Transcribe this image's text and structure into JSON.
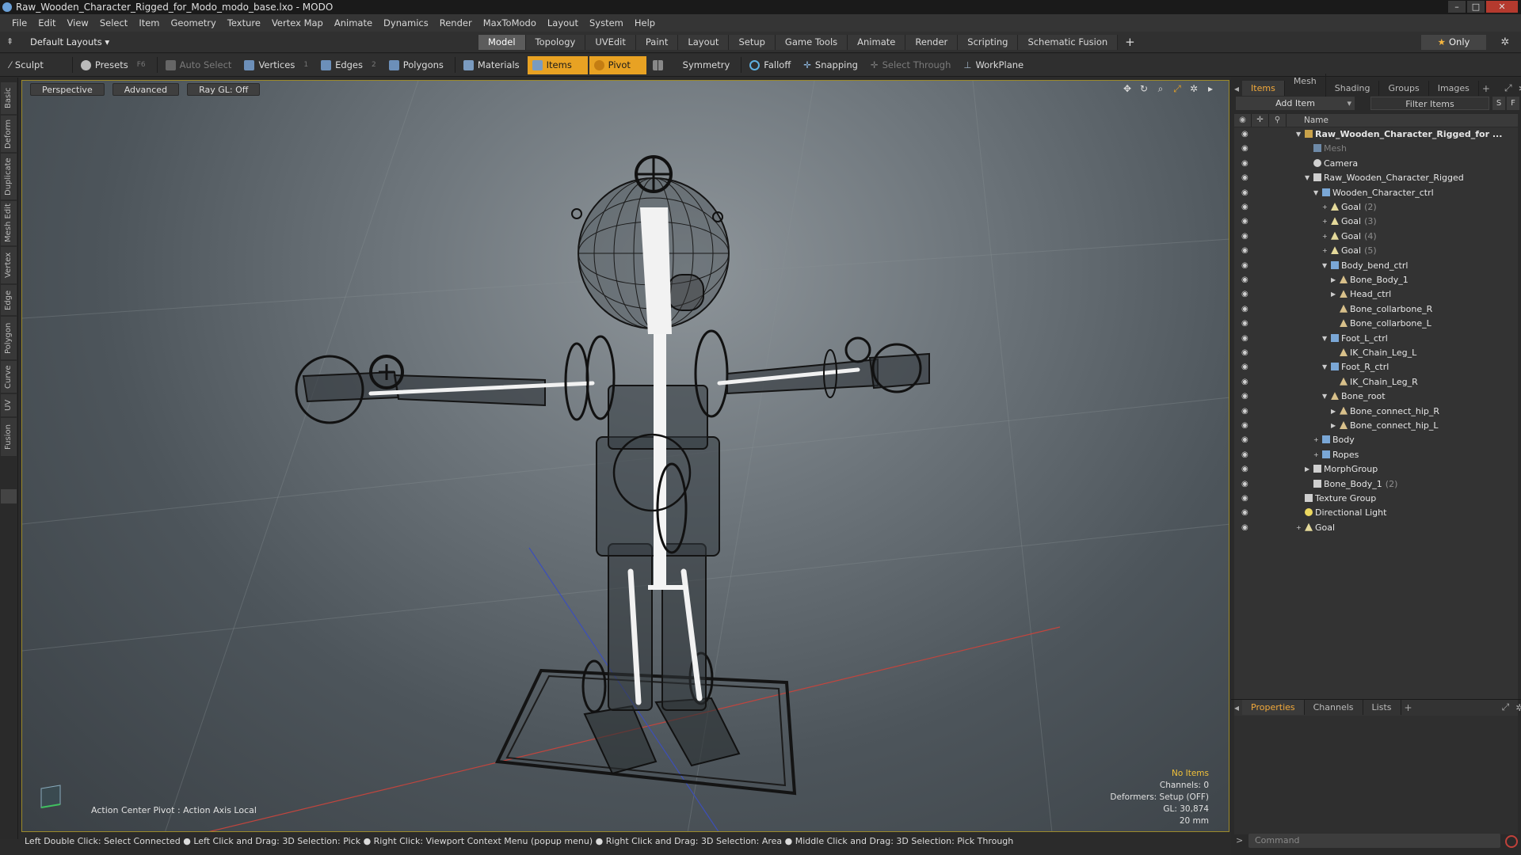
{
  "window": {
    "title": "Raw_Wooden_Character_Rigged_for_Modo_modo_base.lxo - MODO",
    "buttons": [
      "–",
      "□",
      "✕"
    ]
  },
  "menu": [
    "File",
    "Edit",
    "View",
    "Select",
    "Item",
    "Geometry",
    "Texture",
    "Vertex Map",
    "Animate",
    "Dynamics",
    "Render",
    "MaxToModo",
    "Layout",
    "System",
    "Help"
  ],
  "layout": {
    "selector": "Default Layouts ▾",
    "tabs": [
      "Model",
      "Topology",
      "UVEdit",
      "Paint",
      "Layout",
      "Setup",
      "Game Tools",
      "Animate",
      "Render",
      "Scripting",
      "Schematic Fusion"
    ],
    "active_tab": "Model",
    "add_tab": "+",
    "only_label": "Only"
  },
  "toolbar": {
    "sculpt": "Sculpt",
    "presets": "Presets",
    "presets_key": "F6",
    "auto_select": "Auto Select",
    "vertices": "Vertices",
    "vertices_key": "1",
    "edges": "Edges",
    "edges_key": "2",
    "polygons": "Polygons",
    "materials": "Materials",
    "items": "Items",
    "pivot": "Pivot",
    "symmetry": "Symmetry",
    "falloff": "Falloff",
    "snapping": "Snapping",
    "select_through": "Select Through",
    "workplane": "WorkPlane"
  },
  "left_tabs": [
    "Basic",
    "Deform",
    "Duplicate",
    "Mesh Edit",
    "Vertex",
    "Edge",
    "Polygon",
    "Curve",
    "UV",
    "Fusion"
  ],
  "viewport": {
    "view_mode": "Perspective",
    "shading": "Advanced",
    "raygl": "Ray GL: Off",
    "info_noitems": "No Items",
    "info_channels": "Channels: 0",
    "info_deformers": "Deformers: Setup (OFF)",
    "info_gl": "GL: 30,874",
    "info_scale": "20 mm",
    "action_center": "Action Center Pivot : Action Axis Local"
  },
  "status_bar": "Left Double Click: Select Connected ● Left Click and Drag: 3D Selection: Pick ● Right Click: Viewport Context Menu (popup menu) ● Right Click and Drag: 3D Selection: Area ● Middle Click and Drag: 3D Selection: Pick Through",
  "right_panel": {
    "tabs": [
      "Items",
      "Mesh ...",
      "Shading",
      "Groups",
      "Images"
    ],
    "active_tab": "Items",
    "add_item": "Add Item",
    "filter_items": "Filter Items",
    "btn_s": "S",
    "btn_f": "F",
    "col_name": "Name",
    "tree": [
      {
        "label": "Raw_Wooden_Character_Rigged_for ...",
        "indent": 0,
        "exp": "▼",
        "icon": "scene",
        "bold": true
      },
      {
        "label": "Mesh",
        "indent": 1,
        "exp": "",
        "icon": "mesh",
        "dim": true
      },
      {
        "label": "Camera",
        "indent": 1,
        "exp": "",
        "icon": "camera"
      },
      {
        "label": "Raw_Wooden_Character_Rigged",
        "indent": 1,
        "exp": "▼",
        "icon": "group"
      },
      {
        "label": "Wooden_Character_ctrl",
        "indent": 2,
        "exp": "▼",
        "icon": "locator"
      },
      {
        "label": "Goal",
        "count": "(2)",
        "indent": 3,
        "exp": "+",
        "icon": "goal"
      },
      {
        "label": "Goal",
        "count": "(3)",
        "indent": 3,
        "exp": "+",
        "icon": "goal"
      },
      {
        "label": "Goal",
        "count": "(4)",
        "indent": 3,
        "exp": "+",
        "icon": "goal"
      },
      {
        "label": "Goal",
        "count": "(5)",
        "indent": 3,
        "exp": "+",
        "icon": "goal"
      },
      {
        "label": "Body_bend_ctrl",
        "indent": 3,
        "exp": "▼",
        "icon": "locator"
      },
      {
        "label": "Bone_Body_1",
        "indent": 4,
        "exp": "▶",
        "icon": "bone"
      },
      {
        "label": "Head_ctrl",
        "indent": 4,
        "exp": "▶",
        "icon": "bone"
      },
      {
        "label": "Bone_collarbone_R",
        "indent": 4,
        "exp": "",
        "icon": "bone"
      },
      {
        "label": "Bone_collarbone_L",
        "indent": 4,
        "exp": "",
        "icon": "bone"
      },
      {
        "label": "Foot_L_ctrl",
        "indent": 3,
        "exp": "▼",
        "icon": "locator"
      },
      {
        "label": "IK_Chain_Leg_L",
        "indent": 4,
        "exp": "",
        "icon": "bone"
      },
      {
        "label": "Foot_R_ctrl",
        "indent": 3,
        "exp": "▼",
        "icon": "locator"
      },
      {
        "label": "IK_Chain_Leg_R",
        "indent": 4,
        "exp": "",
        "icon": "bone"
      },
      {
        "label": "Bone_root",
        "indent": 3,
        "exp": "▼",
        "icon": "bone"
      },
      {
        "label": "Bone_connect_hip_R",
        "indent": 4,
        "exp": "▶",
        "icon": "bone"
      },
      {
        "label": "Bone_connect_hip_L",
        "indent": 4,
        "exp": "▶",
        "icon": "bone"
      },
      {
        "label": "Body",
        "indent": 2,
        "exp": "+",
        "icon": "locator"
      },
      {
        "label": "Ropes",
        "indent": 2,
        "exp": "+",
        "icon": "locator"
      },
      {
        "label": "MorphGroup",
        "indent": 1,
        "exp": "▶",
        "icon": "group"
      },
      {
        "label": "Bone_Body_1",
        "count": "(2)",
        "indent": 1,
        "exp": "",
        "icon": "group"
      },
      {
        "label": "Texture Group",
        "indent": 0,
        "exp": "",
        "icon": "group"
      },
      {
        "label": "Directional Light",
        "indent": 0,
        "exp": "",
        "icon": "light"
      },
      {
        "label": "Goal",
        "indent": 0,
        "exp": "+",
        "icon": "goal"
      }
    ],
    "props_tabs": [
      "Properties",
      "Channels",
      "Lists"
    ],
    "props_active": "Properties",
    "props_add": "+",
    "command_placeholder": "Command"
  }
}
